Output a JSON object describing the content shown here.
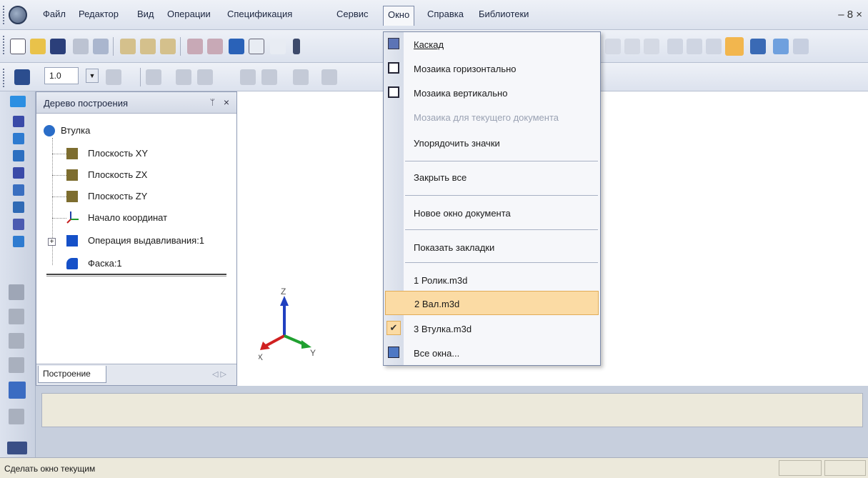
{
  "menubar": {
    "items": [
      "Файл",
      "Редактор",
      "Вид",
      "Операции",
      "Спецификация",
      "Сервис",
      "Окно",
      "Справка",
      "Библиотеки"
    ],
    "window_controls": "– 8 ×"
  },
  "toolbar2": {
    "zoom_value": "1.0"
  },
  "tree_panel": {
    "title": "Дерево построения",
    "pin": "ᛘ",
    "close": "×",
    "root": "Втулка",
    "nodes": [
      "Плоскость XY",
      "Плоскость ZX",
      "Плоскость ZY",
      "Начало координат",
      "Операция выдавливания:1",
      "Фаска:1"
    ],
    "expand": "+",
    "tab": "Построение",
    "tab_arrows": "◁ ▷"
  },
  "axes": {
    "z": "Z",
    "x": "X",
    "y": "Y"
  },
  "window_menu": {
    "items": [
      {
        "label": "Каскад"
      },
      {
        "label": "Мозаика горизонтально"
      },
      {
        "label": "Мозаика вертикально"
      },
      {
        "label": "Мозаика для текущего документа"
      },
      {
        "label": "Упорядочить значки"
      },
      {
        "label": "Закрыть все"
      },
      {
        "label": "Новое окно документа"
      },
      {
        "label": "Показать закладки"
      },
      {
        "label": "1 Ролик.m3d"
      },
      {
        "label": "2 Вал.m3d"
      },
      {
        "label": "3 Втулка.m3d"
      },
      {
        "label": "Все окна..."
      }
    ],
    "check": "✔"
  },
  "statusbar": {
    "text": "Сделать окно текущим"
  },
  "colors": {
    "highlight": "#fbdba4",
    "highlight_border": "#e1ac57",
    "canvas": "#ffffff"
  }
}
